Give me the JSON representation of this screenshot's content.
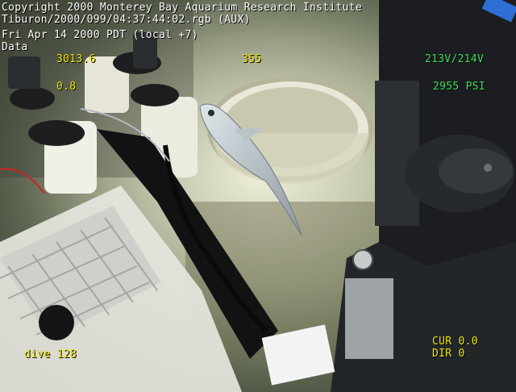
{
  "overlay": {
    "line1": "Copyright 2000 Monterey Bay Aquarium Research Institute",
    "line2": "Tiburon/2000/099/04:37:44:02.rgb (AUX)",
    "line3": "Fri Apr 14 2000 PDT (local +7)",
    "line4": "Data",
    "heading": "3013.6",
    "depth": "355",
    "voltage": "213V/214V",
    "pressure": "2955 PSI",
    "small_val": "0.8",
    "dive": "dive 128",
    "cur": "CUR 0.0",
    "dir": "DIR 0"
  },
  "colors": {
    "overlay_white": "#ffffff",
    "overlay_yellow": "#f2e600",
    "overlay_green": "#3ce05a"
  }
}
